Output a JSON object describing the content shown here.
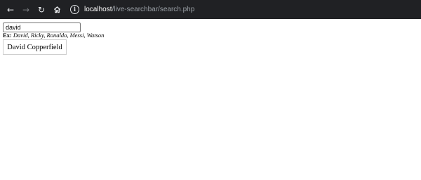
{
  "browser": {
    "icons": {
      "back": "arrow-left-icon",
      "forward": "arrow-right-icon",
      "reload": "reload-icon",
      "home": "home-icon",
      "info": "info-icon"
    },
    "url_host": "localhost",
    "url_path": "/live-searchbar/search.php"
  },
  "search": {
    "value": "david"
  },
  "example": {
    "label": "Ex:",
    "names": "David, Ricky, Ronaldo, Messi, Watson"
  },
  "results": [
    {
      "name": "David Copperfield"
    }
  ]
}
